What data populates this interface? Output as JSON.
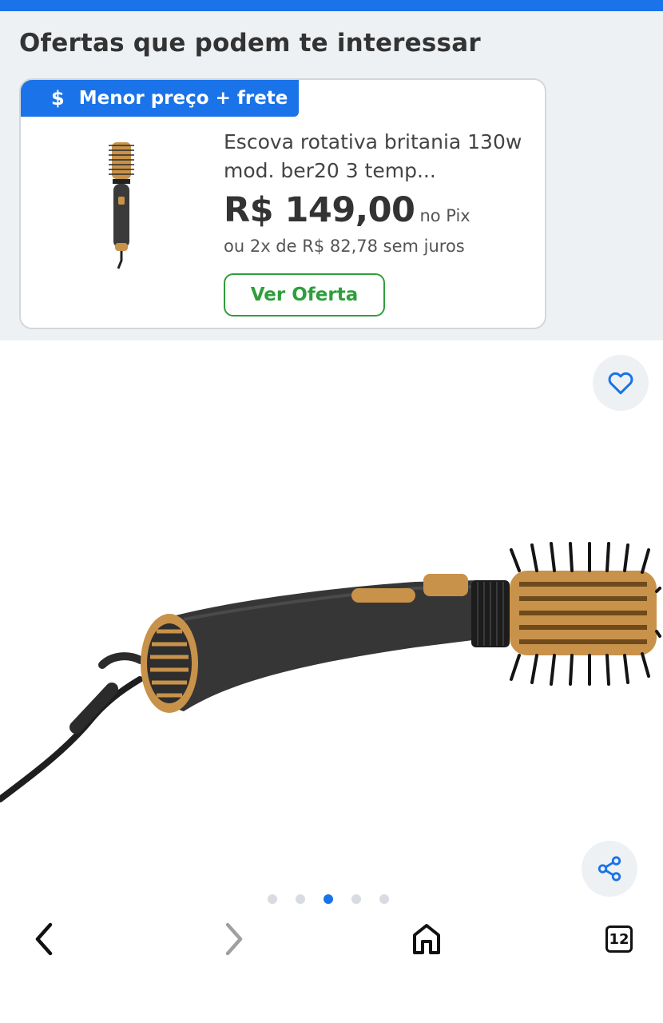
{
  "offers": {
    "title": "Ofertas que podem te interessar",
    "card": {
      "badge": {
        "icon": "dollar-icon",
        "label": "Menor preço + frete"
      },
      "product_name": "Escova rotativa britania 130w mod. ber20 3 temp...",
      "price": "R$ 149,00",
      "price_suffix": "no Pix",
      "installments": "ou 2x de R$ 82,78 sem juros",
      "cta_label": "Ver Oferta"
    }
  },
  "gallery": {
    "favorite_icon": "heart-icon",
    "share_icon": "share-icon",
    "total_images": 5,
    "active_index": 2
  },
  "browser_nav": {
    "back_icon": "chevron-left-icon",
    "forward_icon": "chevron-right-icon",
    "home_icon": "home-icon",
    "tab_count": "12"
  },
  "colors": {
    "accent_blue": "#1a73e8",
    "cta_green": "#2e9e3c",
    "panel_gray": "#eef1f4"
  }
}
